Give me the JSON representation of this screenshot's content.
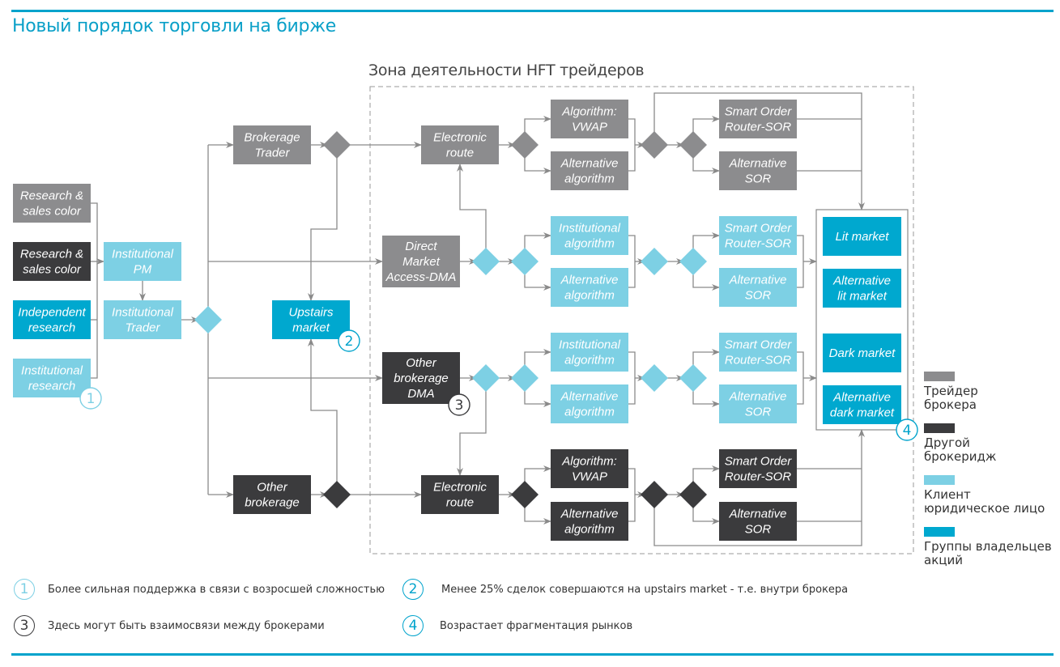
{
  "title": "Новый порядок торговли на бирже",
  "zone_title": "Зона деятельности HFT трейдеров",
  "colors": {
    "broker_trader": "#8c8c8e",
    "other_brokerage": "#3b3b3d",
    "client_legal": "#7dd0e4",
    "shareholder_groups": "#00a8cf",
    "connector": "#8a8a8a",
    "accent": "#00a3cc"
  },
  "nodes": [
    {
      "id": "research-sales-gray",
      "lines": [
        "Research &",
        "sales color"
      ],
      "category": "broker_trader"
    },
    {
      "id": "research-sales-dark",
      "lines": [
        "Research &",
        "sales color"
      ],
      "category": "other_brokerage"
    },
    {
      "id": "independent-research",
      "lines": [
        "Independent",
        "research"
      ],
      "category": "shareholder_groups"
    },
    {
      "id": "institutional-research",
      "lines": [
        "Institutional",
        "research"
      ],
      "category": "client_legal"
    },
    {
      "id": "institutional-pm",
      "lines": [
        "Institutional",
        "PM"
      ],
      "category": "client_legal"
    },
    {
      "id": "institutional-trader",
      "lines": [
        "Institutional",
        "Trader"
      ],
      "category": "client_legal"
    },
    {
      "id": "brokerage-trader",
      "lines": [
        "Brokerage",
        "Trader"
      ],
      "category": "broker_trader"
    },
    {
      "id": "upstairs-market",
      "lines": [
        "Upstairs",
        "market"
      ],
      "category": "shareholder_groups"
    },
    {
      "id": "other-brokerage",
      "lines": [
        "Other",
        "brokerage"
      ],
      "category": "other_brokerage"
    },
    {
      "id": "electronic-route-top",
      "lines": [
        "Electronic",
        "route"
      ],
      "category": "broker_trader"
    },
    {
      "id": "dma",
      "lines": [
        "Direct",
        "Market",
        "Access-DMA"
      ],
      "category": "broker_trader"
    },
    {
      "id": "other-brokerage-dma",
      "lines": [
        "Other",
        "brokerage",
        "DMA"
      ],
      "category": "other_brokerage"
    },
    {
      "id": "electronic-route-bottom",
      "lines": [
        "Electronic",
        "route"
      ],
      "category": "other_brokerage"
    },
    {
      "id": "algo-vwap-top",
      "lines": [
        "Algorithm:",
        "VWAP"
      ],
      "category": "broker_trader"
    },
    {
      "id": "alt-algo-top",
      "lines": [
        "Alternative",
        "algorithm"
      ],
      "category": "broker_trader"
    },
    {
      "id": "inst-algo-1",
      "lines": [
        "Institutional",
        "algorithm"
      ],
      "category": "client_legal"
    },
    {
      "id": "alt-algo-2",
      "lines": [
        "Alternative",
        "algorithm"
      ],
      "category": "client_legal"
    },
    {
      "id": "inst-algo-3",
      "lines": [
        "Institutional",
        "algorithm"
      ],
      "category": "client_legal"
    },
    {
      "id": "alt-algo-3",
      "lines": [
        "Alternative",
        "algorithm"
      ],
      "category": "client_legal"
    },
    {
      "id": "algo-vwap-bottom",
      "lines": [
        "Algorithm:",
        "VWAP"
      ],
      "category": "other_brokerage"
    },
    {
      "id": "alt-algo-bottom",
      "lines": [
        "Alternative",
        "algorithm"
      ],
      "category": "other_brokerage"
    },
    {
      "id": "sor-top",
      "lines": [
        "Smart Order",
        "Router-SOR"
      ],
      "category": "broker_trader"
    },
    {
      "id": "alt-sor-top",
      "lines": [
        "Alternative",
        "SOR"
      ],
      "category": "broker_trader"
    },
    {
      "id": "sor-2",
      "lines": [
        "Smart Order",
        "Router-SOR"
      ],
      "category": "client_legal"
    },
    {
      "id": "alt-sor-2",
      "lines": [
        "Alternative",
        "SOR"
      ],
      "category": "client_legal"
    },
    {
      "id": "sor-3",
      "lines": [
        "Smart Order",
        "Router-SOR"
      ],
      "category": "client_legal"
    },
    {
      "id": "alt-sor-3",
      "lines": [
        "Alternative",
        "SOR"
      ],
      "category": "client_legal"
    },
    {
      "id": "sor-bottom",
      "lines": [
        "Smart Order",
        "Router-SOR"
      ],
      "category": "other_brokerage"
    },
    {
      "id": "alt-sor-bottom",
      "lines": [
        "Alternative",
        "SOR"
      ],
      "category": "other_brokerage"
    },
    {
      "id": "lit-market",
      "lines": [
        "Lit market"
      ],
      "category": "shareholder_groups"
    },
    {
      "id": "alt-lit-market",
      "lines": [
        "Alternative",
        "lit market"
      ],
      "category": "shareholder_groups"
    },
    {
      "id": "dark-market",
      "lines": [
        "Dark market"
      ],
      "category": "shareholder_groups"
    },
    {
      "id": "alt-dark-market",
      "lines": [
        "Alternative",
        "dark market"
      ],
      "category": "shareholder_groups"
    }
  ],
  "markers": [
    {
      "number": "1",
      "attached_to": "institutional-research",
      "color": "#7dd0e4"
    },
    {
      "number": "2",
      "attached_to": "upstairs-market",
      "color": "#00a3cc"
    },
    {
      "number": "3",
      "attached_to": "other-brokerage-dma",
      "color": "#3b3b3d"
    },
    {
      "number": "4",
      "attached_to": "markets-group",
      "color": "#00a3cc"
    }
  ],
  "legend": [
    {
      "label": "Трейдер брокера",
      "lines": [
        "Трейдер",
        "брокера"
      ],
      "color": "#8c8c8e"
    },
    {
      "label": "Другой брокеридж",
      "lines": [
        "Другой",
        "брокеридж"
      ],
      "color": "#3b3b3d"
    },
    {
      "label": "Клиент юридическое лицо",
      "lines": [
        "Клиент",
        "юридическое лицо"
      ],
      "color": "#7dd0e4"
    },
    {
      "label": "Группы владельцев акций",
      "lines": [
        "Группы владельцев",
        "акций"
      ],
      "color": "#00a8cf"
    }
  ],
  "notes": [
    {
      "number": "1",
      "text": "Более сильная поддержка в связи с возросшей сложностью",
      "color": "#7dd0e4"
    },
    {
      "number": "2",
      "text": "Менее 25% сделок совершаются на upstairs market - т.е. внутри брокера",
      "color": "#00a3cc"
    },
    {
      "number": "3",
      "text": "Здесь могут быть взаимосвязи между брокерами",
      "color": "#3b3b3d"
    },
    {
      "number": "4",
      "text": "Возрастает фрагментация рынков",
      "color": "#00a3cc"
    }
  ]
}
